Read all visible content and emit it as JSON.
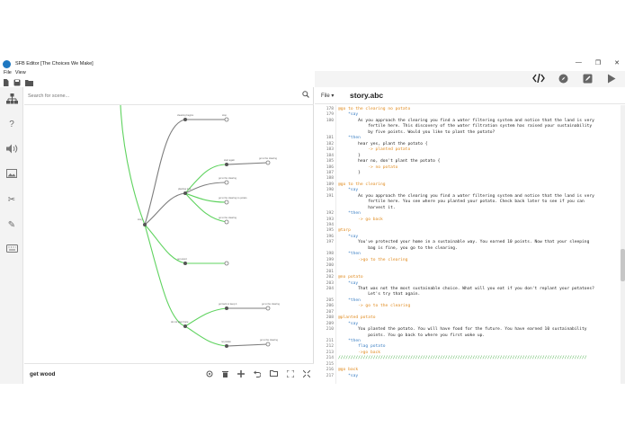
{
  "window": {
    "title": "SFB Editor [The Choices We Make]",
    "controls": [
      "—",
      "❐",
      "✕"
    ]
  },
  "menu": {
    "items": [
      "File",
      "View"
    ]
  },
  "toolbar": {
    "icons": [
      "new-file-icon",
      "save-icon",
      "open-folder-icon"
    ]
  },
  "left_tools": [
    "tree-icon",
    "help-icon",
    "sound-icon",
    "image-icon",
    "scissors-icon",
    "pencil-icon",
    "keyboard-icon"
  ],
  "scene_panel": {
    "search_placeholder": "Search for scene...",
    "current_scene": "get wood",
    "bottom_icons": [
      "target-icon",
      "trash-icon",
      "add-icon",
      "undo-icon",
      "folder-icon",
      "expand-icon",
      "fullscreen-icon"
    ]
  },
  "tree": {
    "colors": {
      "green": "#5fd35f",
      "gray": "#7d7d7d"
    },
    "labels": [
      "cleaning begins",
      "stop",
      "story",
      "go to the clearing",
      "go to the clearing",
      "planting tree",
      "go to the clearing no potato",
      "go to the clearing",
      "start again",
      "get wood",
      "do not plant here",
      "go to the clearing",
      "go back to keep it",
      "no potato",
      "go to the clearing"
    ]
  },
  "editor": {
    "file_menu": "File",
    "file_name": "story.abc",
    "top_icons": [
      "code-icon",
      "compass-icon",
      "edit-icon",
      "play-icon"
    ],
    "lines": [
      {
        "n": "178",
        "t": "@go to the clearing no potato",
        "k": "label"
      },
      {
        "n": "179",
        "t": "    *say",
        "k": "kw"
      },
      {
        "n": "180",
        "t": "        As you approach the clearing you find a water filtering system and notice that the land is very",
        "k": "text"
      },
      {
        "n": "",
        "t": "            fertile here. This discovery of the water filtration system has raised your sustainability",
        "k": "text"
      },
      {
        "n": "",
        "t": "            by five points. Would you like to plant the potato?",
        "k": "text"
      },
      {
        "n": "181",
        "t": "    *then",
        "k": "kw"
      },
      {
        "n": "182",
        "t": "        hear yes, plant the potato {",
        "k": "text"
      },
      {
        "n": "183",
        "t": "            -> planted potato",
        "k": "go"
      },
      {
        "n": "184",
        "t": "        }",
        "k": "text"
      },
      {
        "n": "185",
        "t": "        hear no, don't plant the potato {",
        "k": "text"
      },
      {
        "n": "186",
        "t": "            -> no potato",
        "k": "go"
      },
      {
        "n": "187",
        "t": "        }",
        "k": "text"
      },
      {
        "n": "188",
        "t": "",
        "k": "text"
      },
      {
        "n": "189",
        "t": "@go to the clearing",
        "k": "label"
      },
      {
        "n": "190",
        "t": "    *say",
        "k": "kw"
      },
      {
        "n": "191",
        "t": "        As you approach the clearing you find a water filtering system and notice that the land is very",
        "k": "text"
      },
      {
        "n": "",
        "t": "            fertile here. You see where you planted your potato. Check back later to see if you can",
        "k": "text"
      },
      {
        "n": "",
        "t": "            harvest it.",
        "k": "text"
      },
      {
        "n": "192",
        "t": "    *then",
        "k": "kw"
      },
      {
        "n": "193",
        "t": "        -> go back",
        "k": "go"
      },
      {
        "n": "194",
        "t": "",
        "k": "text"
      },
      {
        "n": "195",
        "t": "@tarp",
        "k": "label"
      },
      {
        "n": "196",
        "t": "    *say",
        "k": "kw"
      },
      {
        "n": "197",
        "t": "        You've protected your home in a sustainable way. You earned 10 points. Now that your sleeping",
        "k": "text"
      },
      {
        "n": "",
        "t": "            bag is fine, you go to the clearing.",
        "k": "text"
      },
      {
        "n": "198",
        "t": "    *then",
        "k": "kw"
      },
      {
        "n": "199",
        "t": "        ->go to the clearing",
        "k": "go"
      },
      {
        "n": "200",
        "t": "",
        "k": "text"
      },
      {
        "n": "201",
        "t": "",
        "k": "text"
      },
      {
        "n": "202",
        "t": "@no potato",
        "k": "label"
      },
      {
        "n": "203",
        "t": "    *say",
        "k": "kw"
      },
      {
        "n": "204",
        "t": "        That was not the most sustainable choice. What will you eat if you don't replant your potatoes?",
        "k": "text"
      },
      {
        "n": "",
        "t": "            Let's try that again.",
        "k": "text"
      },
      {
        "n": "205",
        "t": "    *then",
        "k": "kw"
      },
      {
        "n": "206",
        "t": "        -> go to the clearing",
        "k": "go"
      },
      {
        "n": "207",
        "t": "",
        "k": "text"
      },
      {
        "n": "208",
        "t": "@planted potato",
        "k": "label"
      },
      {
        "n": "209",
        "t": "    *say",
        "k": "kw"
      },
      {
        "n": "210",
        "t": "        You planted the potato. You will have food for the future. You have earned 10 sustainability",
        "k": "text"
      },
      {
        "n": "",
        "t": "            points. You go back to where you first woke up.",
        "k": "text"
      },
      {
        "n": "211",
        "t": "    *then",
        "k": "kw"
      },
      {
        "n": "212",
        "t": "        flag potato",
        "k": "kw"
      },
      {
        "n": "213",
        "t": "        ->go back",
        "k": "go"
      },
      {
        "n": "214",
        "t": "////////////////////////////////////////////////////////////////////////////////////////////////////",
        "k": "comment"
      },
      {
        "n": "215",
        "t": "",
        "k": "text"
      },
      {
        "n": "216",
        "t": "@go back",
        "k": "label"
      },
      {
        "n": "217",
        "t": "    *say",
        "k": "kw"
      }
    ]
  }
}
